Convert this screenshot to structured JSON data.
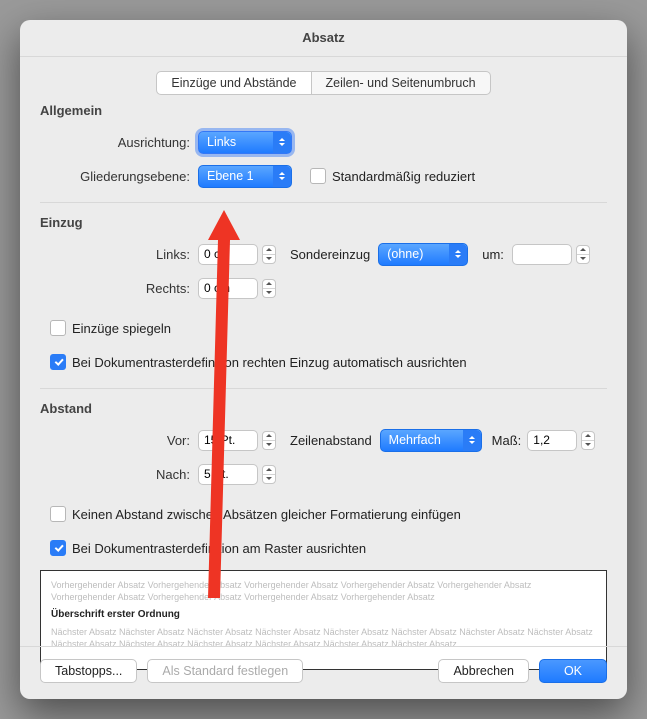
{
  "title": "Absatz",
  "tabs": {
    "t1": "Einzüge und Abstände",
    "t2": "Zeilen- und Seitenumbruch"
  },
  "general": {
    "title": "Allgemein",
    "align_label": "Ausrichtung:",
    "align_value": "Links",
    "outline_label": "Gliederungsebene:",
    "outline_value": "Ebene 1",
    "collapsed_label": "Standardmäßig reduziert"
  },
  "indent": {
    "title": "Einzug",
    "left_label": "Links:",
    "left_value": "0 cm",
    "right_label": "Rechts:",
    "right_value": "0 cm",
    "special_label": "Sondereinzug",
    "special_value": "(ohne)",
    "by_label": "um:",
    "by_value": "",
    "mirror_label": "Einzüge spiegeln",
    "grid_label": "Bei Dokumentrasterdefinition rechten Einzug automatisch ausrichten"
  },
  "spacing": {
    "title": "Abstand",
    "before_label": "Vor:",
    "before_value": "15 Pt.",
    "after_label": "Nach:",
    "after_value": "5 Pt.",
    "line_label": "Zeilenabstand",
    "line_value": "Mehrfach",
    "at_label": "Maß:",
    "at_value": "1,2",
    "nospace_label": "Keinen Abstand zwischen Absätzen gleicher Formatierung einfügen",
    "grid_label": "Bei Dokumentrasterdefinition am Raster ausrichten"
  },
  "preview": {
    "before": "Vorhergehender Absatz Vorhergehender Absatz Vorhergehender Absatz Vorhergehender Absatz Vorhergehender Absatz Vorhergehender Absatz Vorhergehender Absatz Vorhergehender Absatz Vorhergehender Absatz",
    "sample": "Überschrift erster Ordnung",
    "after": "Nächster Absatz Nächster Absatz Nächster Absatz Nächster Absatz Nächster Absatz Nächster Absatz Nächster Absatz Nächster Absatz Nächster Absatz Nächster Absatz Nächster Absatz Nächster Absatz Nächster Absatz Nächster Absatz"
  },
  "footer": {
    "tabs": "Tabstopps...",
    "default": "Als Standard festlegen",
    "cancel": "Abbrechen",
    "ok": "OK"
  }
}
